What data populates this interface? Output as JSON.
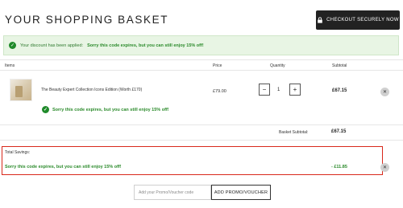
{
  "header": {
    "title": "YOUR SHOPPING BASKET",
    "checkout_label": "CHECKOUT SECURELY NOW"
  },
  "notice": {
    "applied_text": "Your discount has been applied:",
    "message": "Sorry this code expires, but you can still enjoy 15% off!"
  },
  "table": {
    "columns": {
      "items": "Items",
      "price": "Price",
      "quantity": "Quantity",
      "subtotal": "Subtotal"
    }
  },
  "item": {
    "name": "The Beauty Expert Collection Icons Edition (Worth £170)",
    "price": "£79.00",
    "quantity": "1",
    "subtotal": "£67.15",
    "message": "Sorry this code expires, but you can still enjoy 15% off!"
  },
  "basket": {
    "subtotal_label": "Basket Subtotal:",
    "subtotal_value": "£67.15"
  },
  "savings": {
    "title": "Total Savings:",
    "message": "Sorry this code expires, but you can still enjoy 15% off!",
    "value": "- £11.85"
  },
  "promo": {
    "placeholder": "Add your Promo/Voucher code",
    "button_label": "ADD PROMO/VOUCHER"
  },
  "colors": {
    "success_green": "#2a8a2a",
    "highlight_red": "#d8281b",
    "button_dark": "#222222"
  }
}
